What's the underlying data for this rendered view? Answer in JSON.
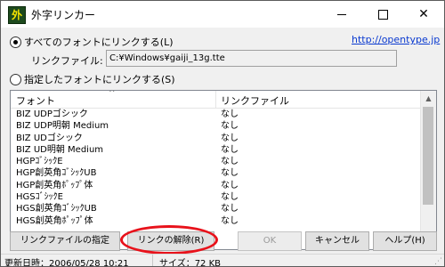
{
  "window": {
    "title": "外字リンカー",
    "app_icon_glyph": "外"
  },
  "options": {
    "all_fonts_label": "すべてのフォントにリンクする(L)",
    "selected_fonts_label": "指定したフォントにリンクする(S)",
    "selected_option": "all",
    "link_file_label": "リンクファイル:",
    "link_file_value": "C:¥Windows¥gaiji_13g.tte",
    "website_link": "http://opentype.jp"
  },
  "table": {
    "columns": [
      "フォント",
      "リンクファイル"
    ],
    "rows": [
      [
        "BIZ UDPゴシック",
        "なし"
      ],
      [
        "BIZ UDP明朝 Medium",
        "なし"
      ],
      [
        "BIZ UDゴシック",
        "なし"
      ],
      [
        "BIZ UD明朝 Medium",
        "なし"
      ],
      [
        "HGPｺﾞｼｯｸE",
        "なし"
      ],
      [
        "HGP創英角ｺﾞｼｯｸUB",
        "なし"
      ],
      [
        "HGP創英角ﾎﾟｯﾌﾟ体",
        "なし"
      ],
      [
        "HGSｺﾞｼｯｸE",
        "なし"
      ],
      [
        "HGS創英角ｺﾞｼｯｸUB",
        "なし"
      ],
      [
        "HGS創英角ﾎﾟｯﾌﾟ体",
        "なし"
      ]
    ]
  },
  "buttons": {
    "specify_link_file": "リンクファイルの指定(F)...",
    "unlink": "リンクの解除(R)",
    "ok": "OK",
    "cancel": "キャンセル",
    "help": "ヘルプ(H)"
  },
  "status": {
    "updated": "更新日時：2006/05/28 10:21",
    "size": "サイズ：72 KB"
  },
  "colors": {
    "highlight": "#e8121b",
    "link": "#0a3ad0"
  }
}
